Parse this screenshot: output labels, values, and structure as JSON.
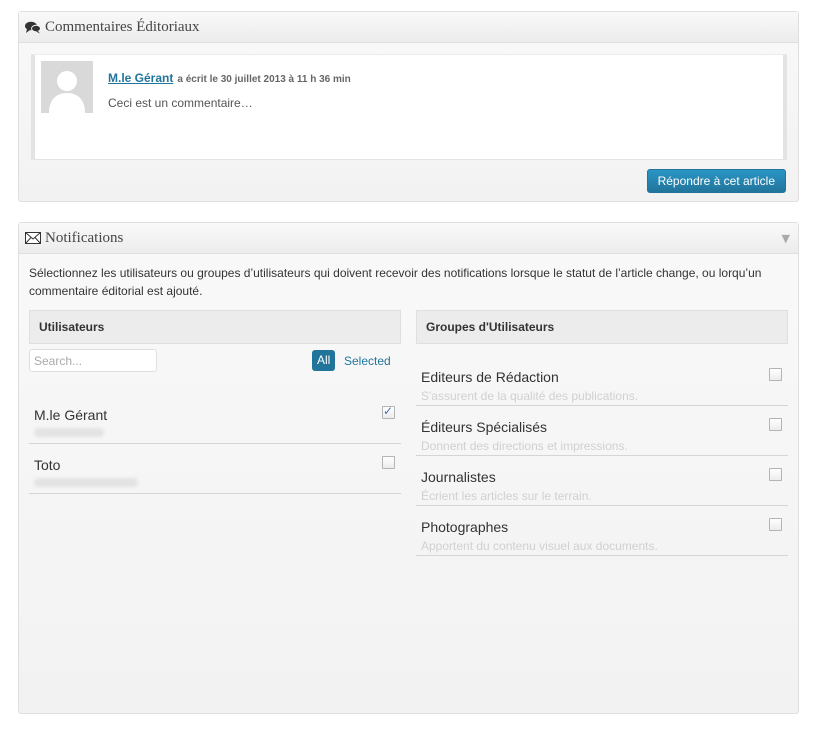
{
  "comments": {
    "title": "Commentaires Éditoriaux",
    "author": "M.le Gérant",
    "meta": "a écrit le 30 juillet 2013 à 11 h 36 min",
    "text": "Ceci est un commentaire…",
    "reply_label": "Répondre à cet article"
  },
  "notifications": {
    "title": "Notifications",
    "description": "Sélectionnez les utilisateurs ou groupes d’utilisateurs qui doivent recevoir des notifications lorsque le statut de l’article change, ou lorqu’un commentaire éditorial est ajouté.",
    "users_header": "Utilisateurs",
    "groups_header": "Groupes d'Utilisateurs",
    "search_placeholder": "Search...",
    "filter_all": "All",
    "filter_selected": "Selected",
    "users": [
      {
        "name": "M.le Gérant",
        "checked": true
      },
      {
        "name": "Toto",
        "checked": false
      }
    ],
    "groups": [
      {
        "name": "Editeurs de Rédaction",
        "desc": "S'assurent de la qualité des publications.",
        "checked": false
      },
      {
        "name": "Éditeurs Spécialisés",
        "desc": "Donnent des directions et impressions.",
        "checked": false
      },
      {
        "name": "Journalistes",
        "desc": "Écrient les articles sur le terrain.",
        "checked": false
      },
      {
        "name": "Photographes",
        "desc": "Apportent du contenu visuel aux documents.",
        "checked": false
      }
    ]
  },
  "icons": {
    "comments": "speech-bubbles-icon",
    "notifications": "envelope-icon",
    "toggle": "triangle-down-icon"
  }
}
